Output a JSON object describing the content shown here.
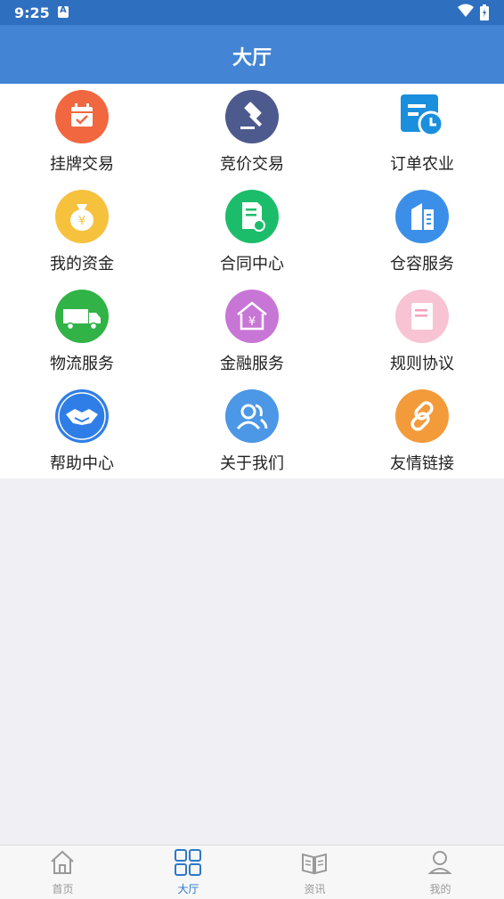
{
  "status_bar": {
    "time": "9:25"
  },
  "app_bar": {
    "title": "大厅"
  },
  "grid": [
    {
      "label": "挂牌交易",
      "icon": "calendar-icon",
      "color": "#f1673f"
    },
    {
      "label": "竞价交易",
      "icon": "gavel-icon",
      "color": "#4d5a8e"
    },
    {
      "label": "订单农业",
      "icon": "order-clock-icon",
      "color": "#1a8fdd"
    },
    {
      "label": "我的资金",
      "icon": "money-bag-icon",
      "color": "#f6c13d"
    },
    {
      "label": "合同中心",
      "icon": "contract-icon",
      "color": "#1cbd6a"
    },
    {
      "label": "仓容服务",
      "icon": "warehouse-icon",
      "color": "#3c8fe8"
    },
    {
      "label": "物流服务",
      "icon": "truck-icon",
      "color": "#31b347"
    },
    {
      "label": "金融服务",
      "icon": "finance-house-icon",
      "color": "#c876d6"
    },
    {
      "label": "规则协议",
      "icon": "document-icon",
      "color": "#f8c3d3"
    },
    {
      "label": "帮助中心",
      "icon": "handshake-icon",
      "color": "#2f7ee8"
    },
    {
      "label": "关于我们",
      "icon": "users-icon",
      "color": "#4c97e6"
    },
    {
      "label": "友情链接",
      "icon": "link-icon",
      "color": "#f39b3a"
    }
  ],
  "bottom_nav": [
    {
      "label": "首页",
      "icon": "home-icon"
    },
    {
      "label": "大厅",
      "icon": "grid-icon",
      "active": true
    },
    {
      "label": "资讯",
      "icon": "news-icon"
    },
    {
      "label": "我的",
      "icon": "profile-icon"
    }
  ]
}
